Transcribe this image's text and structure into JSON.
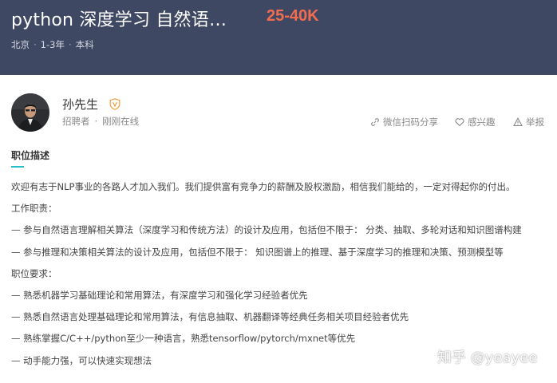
{
  "job": {
    "title": "python 深度学习 自然语…",
    "salary": "25-40K",
    "meta": [
      "北京",
      "1-3年",
      "本科"
    ]
  },
  "recruiter": {
    "name": "孙先生",
    "role": "招聘者",
    "status": "刚刚在线",
    "badge_icon": "verified-shield-icon"
  },
  "actions": {
    "share": "微信扫码分享",
    "interest": "感兴趣",
    "report": "举报"
  },
  "section": {
    "title": "职位描述"
  },
  "description": [
    "欢迎有志于NLP事业的各路人才加入我们。我们提供富有竞争力的薪酬及股权激励，相信我们能给的，一定对得起你的付出。",
    "工作职责：",
    "— 参与自然语言理解相关算法（深度学习和传统方法）的设计及应用，包括但不限于： 分类、抽取、多轮对话和知识图谱构建",
    "— 参与推理和决策相关算法的设计及应用，包括但不限于： 知识图谱上的推理、基于深度学习的推理和决策、预测模型等",
    "职位要求：",
    "— 熟悉机器学习基础理论和常用算法，有深度学习和强化学习经验者优先",
    "— 熟悉自然语言处理基础理论和常用算法，有信息抽取、机器翻译等经典任务相关项目经验者优先",
    "— 熟练掌握C/C++/python至少一种语言，熟悉tensorflow/pytorch/mxnet等优先",
    "— 动手能力强，可以快速实现想法"
  ],
  "watermark": "知乎 @yeayee",
  "colors": {
    "header_bg": "#3f4863",
    "salary": "#f26d4f",
    "accent": "#23c0c9",
    "badge": "#f5a34a"
  }
}
